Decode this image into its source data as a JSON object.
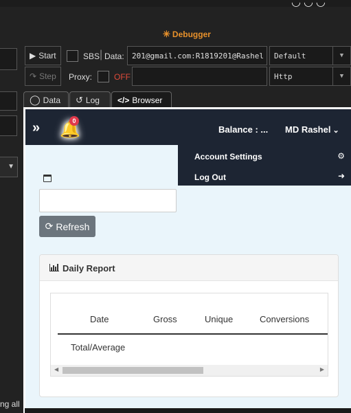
{
  "app": {
    "debugger_title": "Debugger",
    "top_glyphs": "◡◡◡"
  },
  "toolbar": {
    "start_label": "Start",
    "step_label": "Step",
    "sbs_label": "SBS",
    "data_label": "Data:",
    "data_value": "201@gmail.com:R1819201@Rashel",
    "proxy_label": "Proxy:",
    "proxy_state": "OFF",
    "proxy_value": "",
    "mode_select": "Default",
    "proxy_type_select": "Http"
  },
  "tabs": [
    {
      "label": "Data"
    },
    {
      "label": "Log"
    },
    {
      "label": "Browser"
    }
  ],
  "left_panel": {
    "bottom_text": "ng all"
  },
  "page": {
    "notification_count": "0",
    "balance_label": "Balance : ...",
    "user_name": "MD Rashel",
    "dropdown": [
      {
        "label": "Account Settings",
        "icon": "gear-icon"
      },
      {
        "label": "Log Out",
        "icon": "sign-out-icon"
      }
    ],
    "date_input_value": "",
    "refresh_label": "Refresh",
    "report_title": "Daily Report",
    "table": {
      "columns": [
        "Date",
        "Gross",
        "Unique",
        "Conversions"
      ],
      "rows": [
        [
          "Total/Average",
          "",
          "",
          ""
        ]
      ]
    }
  },
  "colors": {
    "accent_orange": "#e8912b",
    "off_red": "#e04b3a",
    "browser_header": "#1d2533",
    "page_bg": "#eaf5fb",
    "badge": "#e0394b"
  }
}
